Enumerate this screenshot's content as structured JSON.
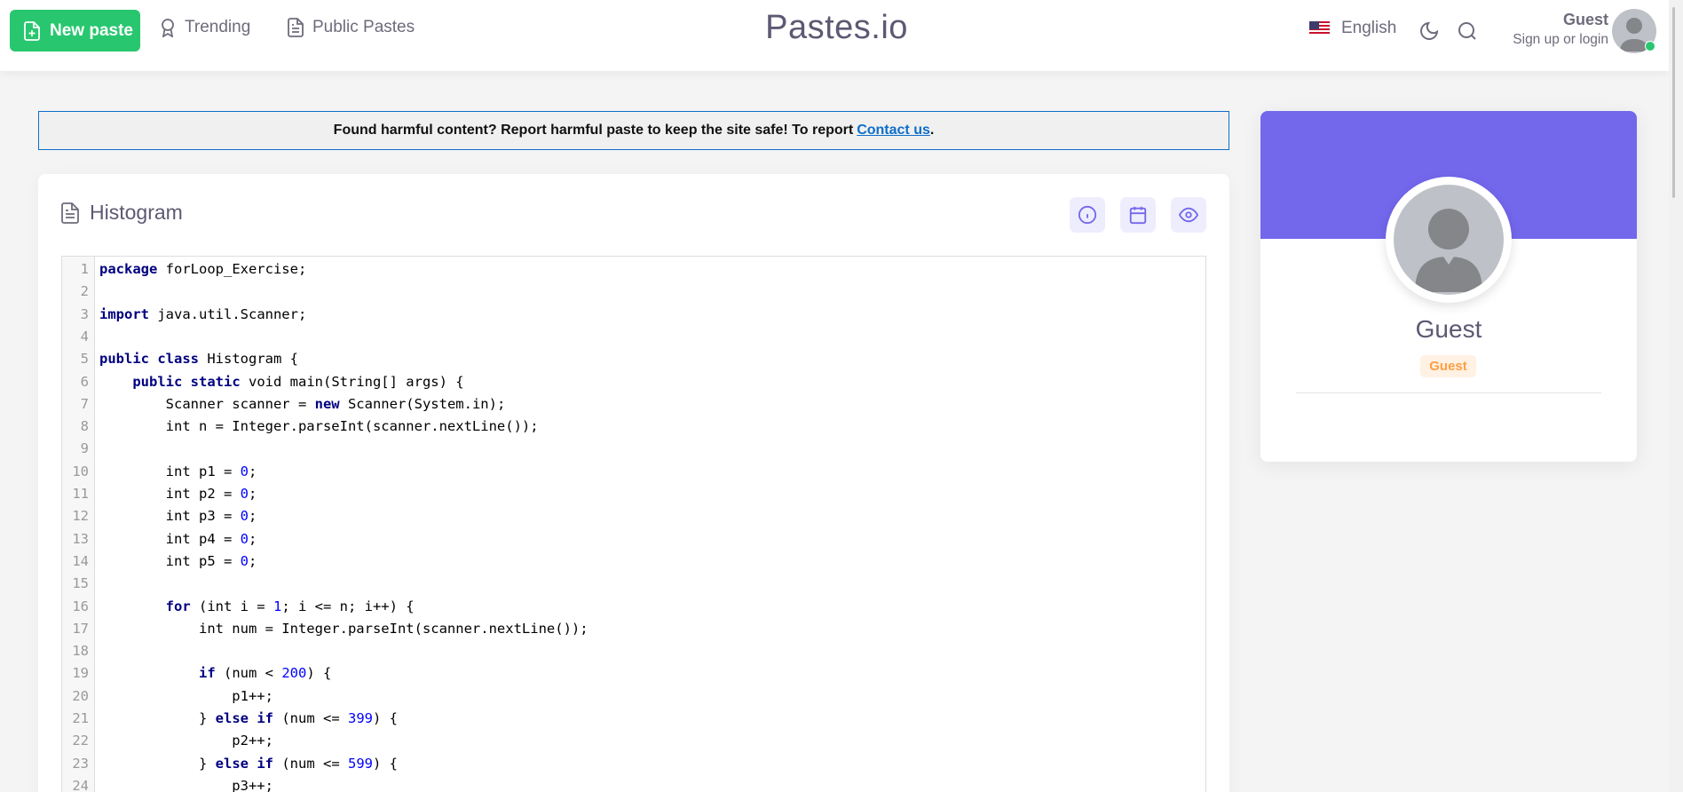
{
  "header": {
    "new_paste_label": "New paste",
    "nav": [
      {
        "label": "Trending",
        "icon": "award-icon"
      },
      {
        "label": "Public Pastes",
        "icon": "file-text-icon"
      }
    ],
    "brand": "Pastes.io",
    "language": "English",
    "user": {
      "name": "Guest",
      "subtitle": "Sign up or login",
      "status": "online"
    }
  },
  "notice": {
    "text": "Found harmful content? Report harmful paste to keep the site safe! To report",
    "link_label": "Contact us",
    "suffix": "."
  },
  "paste": {
    "title": "Histogram",
    "actions": [
      {
        "name": "info",
        "icon": "info-icon"
      },
      {
        "name": "calendar",
        "icon": "calendar-icon"
      },
      {
        "name": "views",
        "icon": "eye-icon"
      }
    ],
    "code_lines": [
      "package forLoop_Exercise;",
      "",
      "import java.util.Scanner;",
      "",
      "public class Histogram {",
      "    public static void main(String[] args) {",
      "        Scanner scanner = new Scanner(System.in);",
      "        int n = Integer.parseInt(scanner.nextLine());",
      "",
      "        int p1 = 0;",
      "        int p2 = 0;",
      "        int p3 = 0;",
      "        int p4 = 0;",
      "        int p5 = 0;",
      "",
      "        for (int i = 1; i <= n; i++) {",
      "            int num = Integer.parseInt(scanner.nextLine());",
      "",
      "            if (num < 200) {",
      "                p1++;",
      "            } else if (num <= 399) {",
      "                p2++;",
      "            } else if (num <= 599) {",
      "                p3++;"
    ]
  },
  "profile": {
    "name": "Guest",
    "role_badge": "Guest"
  },
  "colors": {
    "accent": "#7367ec",
    "success": "#28c76f",
    "warning": "#ff9f43",
    "link": "#0d6ec9"
  }
}
